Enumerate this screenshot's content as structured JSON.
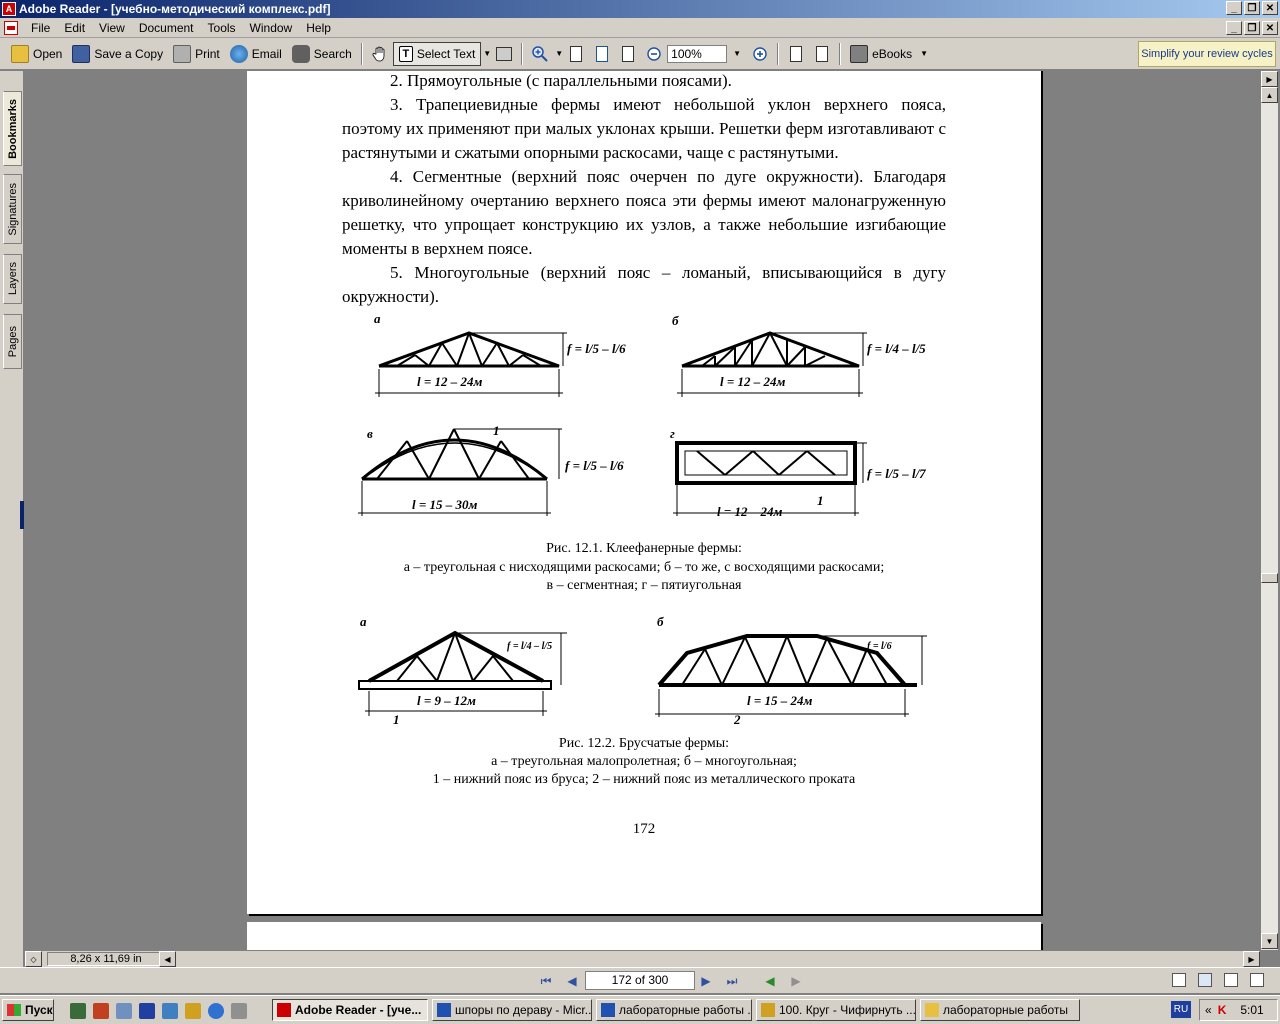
{
  "window": {
    "title": "Adobe Reader - [учебно-методический комплекс.pdf]",
    "buttons": [
      "_",
      "❐",
      "✕"
    ]
  },
  "menu": [
    "File",
    "Edit",
    "View",
    "Document",
    "Tools",
    "Window",
    "Help"
  ],
  "toolbar": {
    "open": "Open",
    "save_copy": "Save a Copy",
    "print": "Print",
    "email": "Email",
    "search": "Search",
    "select_text": "Select Text",
    "zoom": "100%",
    "ebooks": "eBooks",
    "promo": "Simplify your review cycles"
  },
  "nav_tabs": [
    "Bookmarks",
    "Signatures",
    "Layers",
    "Pages"
  ],
  "document": {
    "top_line": "2. Прямоугольные (с параллельными поясами).",
    "para3": "3. Трапециевидные фермы имеют небольшой уклон верхнего пояса, поэтому их применяют при малых уклонах крыши. Решетки ферм изготавливают с растянутыми и сжатыми опорными раскосами, чаще с растянутыми.",
    "para4": "4. Сегментные (верхний пояс очерчен по дуге окружности). Благодаря криволинейному очертанию верхнего пояса эти фермы имеют малонагруженную решетку, что упрощает конструкцию их узлов, а также небольшие изгибающие моменты в верхнем поясе.",
    "para5": "5. Многоугольные (верхний пояс – ломаный, вписывающийся в дугу окружности).",
    "fig1": {
      "labels": {
        "a": "а",
        "b": "б",
        "v": "в",
        "g": "г"
      },
      "dims": {
        "a_span": "l = 12 – 24м",
        "a_height": "f = l/5 – l/6",
        "b_span": "l = 12 – 24м",
        "b_height": "f = l/4 – l/5",
        "v_span": "l = 15 – 30м",
        "v_height": "f = l/5 – l/6",
        "g_span": "l = 12 – 24м",
        "g_height": "f = l/5 – l/7",
        "mark1": "1"
      },
      "caption_title": "Рис. 12.1. Клеефанерные фермы:",
      "caption_line1": "а – треугольная с нисходящими раскосами; б – то же, с восходящими раскосами;",
      "caption_line2": "в – сегментная; г – пятиугольная"
    },
    "fig2": {
      "labels": {
        "a": "а",
        "b": "б"
      },
      "dims": {
        "a_span": "l = 9 – 12м",
        "a_height": "f = l/4 – l/5",
        "b_span": "l = 15 – 24м",
        "b_height": "f = l/6",
        "mark1": "1",
        "mark2": "2"
      },
      "caption_title": "Рис. 12.2. Брусчатые фермы:",
      "caption_line1": "а – треугольная малопролетная; б – многоугольная;",
      "caption_line2": "1 – нижний пояс из бруса; 2 – нижний пояс из металлического проката"
    },
    "page_number": "172"
  },
  "status": {
    "page_size": "8,26 x 11,69 in",
    "page_field": "172 of 300"
  },
  "taskbar": {
    "start": "Пуск",
    "tasks": [
      "Adobe Reader - [уче...",
      "шпоры по дераву - Micr...",
      "лабораторные работы ...",
      "100. Круг - Чифирнуть ...",
      "лабораторные работы"
    ],
    "lang": "RU",
    "clock": "5:01"
  }
}
